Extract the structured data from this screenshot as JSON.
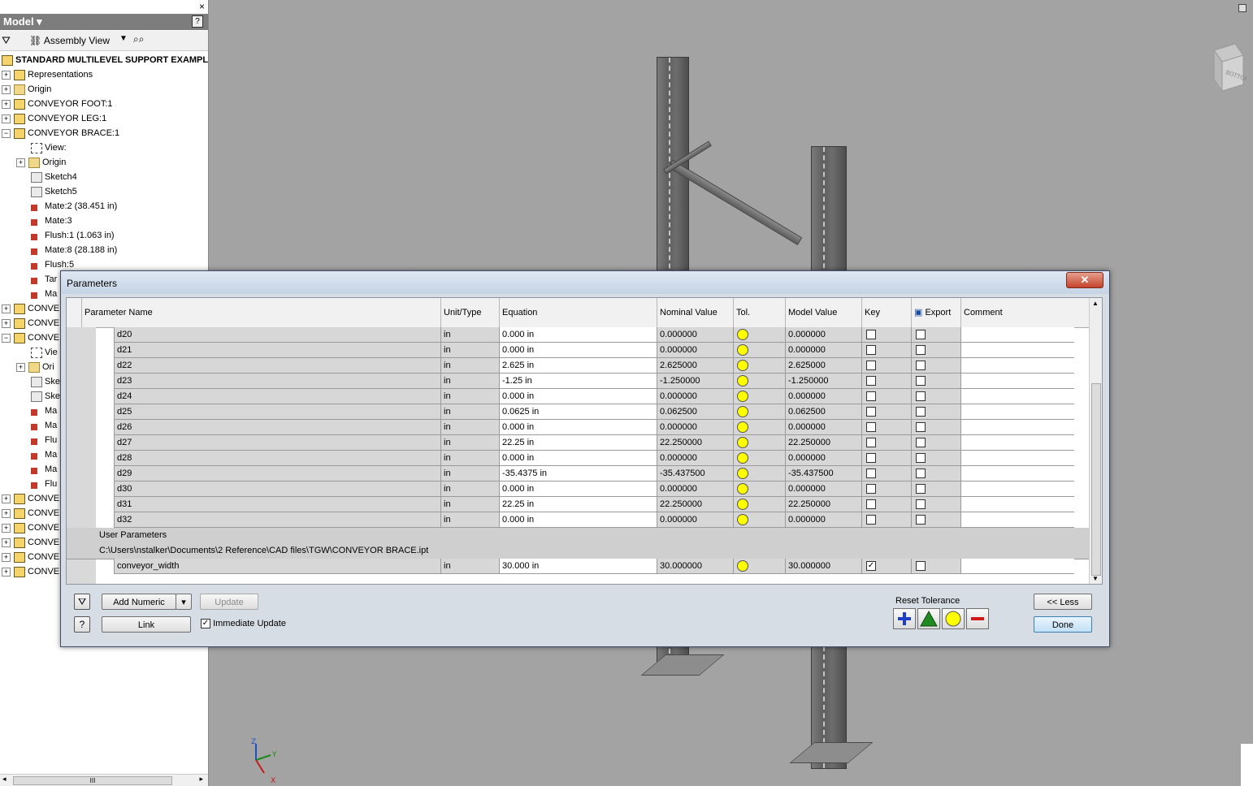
{
  "browser": {
    "title": "Model",
    "help": "?",
    "close": "×",
    "view_label": "Assembly View",
    "root": "STANDARD MULTILEVEL SUPPORT EXAMPL",
    "items": [
      {
        "label": "Representations",
        "icon": "representations-icon",
        "expander": "+"
      },
      {
        "label": "Origin",
        "icon": "folder-icon",
        "expander": "+"
      },
      {
        "label": "CONVEYOR FOOT:1",
        "icon": "part-icon",
        "expander": "+"
      },
      {
        "label": "CONVEYOR LEG:1",
        "icon": "part-icon",
        "expander": "+"
      },
      {
        "label": "CONVEYOR BRACE:1",
        "icon": "part-icon",
        "expander": "−"
      }
    ],
    "brace_children": [
      {
        "label": "View:",
        "icon": "view-icon"
      },
      {
        "label": "Origin",
        "icon": "folder-icon"
      },
      {
        "label": "Sketch4",
        "icon": "sketch-icon"
      },
      {
        "label": "Sketch5",
        "icon": "sketch-icon"
      },
      {
        "label": "Mate:2 (38.451 in)",
        "icon": "mate-icon"
      },
      {
        "label": "Mate:3",
        "icon": "mate-icon"
      },
      {
        "label": "Flush:1 (1.063 in)",
        "icon": "flush-icon"
      },
      {
        "label": "Mate:8 (28.188 in)",
        "icon": "mate-icon"
      },
      {
        "label": "Flush:5",
        "icon": "flush-icon"
      },
      {
        "label": "Tar",
        "icon": "tangent-icon"
      },
      {
        "label": "Ma",
        "icon": "mate-icon"
      }
    ],
    "more_items": [
      {
        "label": "CONVE"
      },
      {
        "label": "CONVE"
      },
      {
        "label": "CONVE"
      }
    ],
    "sub2": [
      {
        "label": "Vie"
      },
      {
        "label": "Ori"
      },
      {
        "label": "Ske"
      },
      {
        "label": "Ske"
      },
      {
        "label": "Ma"
      },
      {
        "label": "Ma"
      },
      {
        "label": "Flu"
      },
      {
        "label": "Ma"
      },
      {
        "label": "Ma"
      },
      {
        "label": "Flu"
      }
    ],
    "tail_items": [
      {
        "label": "CONVE"
      },
      {
        "label": "CONVE"
      },
      {
        "label": "CONVE"
      },
      {
        "label": "CONVE"
      },
      {
        "label": "CONVE"
      },
      {
        "label": "CONVE"
      }
    ],
    "scroll_thumb": "III"
  },
  "viewport": {
    "axes": {
      "z": "Z",
      "y": "Y",
      "x": "X"
    },
    "viewcube_label": "BOTTOM"
  },
  "dialog": {
    "title": "Parameters",
    "close": "✕",
    "columns": [
      "Parameter Name",
      "Unit/Type",
      "Equation",
      "Nominal Value",
      "Tol.",
      "Model Value",
      "Key",
      "Export",
      "Comment"
    ],
    "rows": [
      {
        "name": "d20",
        "unit": "in",
        "equation": "0.000 in",
        "nominal": "0.000000",
        "model": "0.000000",
        "key": false,
        "export": false
      },
      {
        "name": "d21",
        "unit": "in",
        "equation": "0.000 in",
        "nominal": "0.000000",
        "model": "0.000000",
        "key": false,
        "export": false
      },
      {
        "name": "d22",
        "unit": "in",
        "equation": "2.625 in",
        "nominal": "2.625000",
        "model": "2.625000",
        "key": false,
        "export": false
      },
      {
        "name": "d23",
        "unit": "in",
        "equation": "-1.25 in",
        "nominal": "-1.250000",
        "model": "-1.250000",
        "key": false,
        "export": false
      },
      {
        "name": "d24",
        "unit": "in",
        "equation": "0.000 in",
        "nominal": "0.000000",
        "model": "0.000000",
        "key": false,
        "export": false
      },
      {
        "name": "d25",
        "unit": "in",
        "equation": "0.0625 in",
        "nominal": "0.062500",
        "model": "0.062500",
        "key": false,
        "export": false
      },
      {
        "name": "d26",
        "unit": "in",
        "equation": "0.000 in",
        "nominal": "0.000000",
        "model": "0.000000",
        "key": false,
        "export": false
      },
      {
        "name": "d27",
        "unit": "in",
        "equation": "22.25 in",
        "nominal": "22.250000",
        "model": "22.250000",
        "key": false,
        "export": false
      },
      {
        "name": "d28",
        "unit": "in",
        "equation": "0.000 in",
        "nominal": "0.000000",
        "model": "0.000000",
        "key": false,
        "export": false
      },
      {
        "name": "d29",
        "unit": "in",
        "equation": "-35.4375 in",
        "nominal": "-35.437500",
        "model": "-35.437500",
        "key": false,
        "export": false
      },
      {
        "name": "d30",
        "unit": "in",
        "equation": "0.000 in",
        "nominal": "0.000000",
        "model": "0.000000",
        "key": false,
        "export": false
      },
      {
        "name": "d31",
        "unit": "in",
        "equation": "22.25 in",
        "nominal": "22.250000",
        "model": "22.250000",
        "key": false,
        "export": false
      },
      {
        "name": "d32",
        "unit": "in",
        "equation": "0.000 in",
        "nominal": "0.000000",
        "model": "0.000000",
        "key": false,
        "export": false
      }
    ],
    "user_params_label": "User Parameters",
    "file_path": "C:\\Users\\nstalker\\Documents\\2 Reference\\CAD files\\TGW\\CONVEYOR BRACE.ipt",
    "user_rows": [
      {
        "name": "conveyor_width",
        "unit": "in",
        "equation": "30.000 in",
        "nominal": "30.000000",
        "model": "30.000000",
        "key": true,
        "export": false
      }
    ],
    "buttons": {
      "add_numeric": "Add Numeric",
      "update": "Update",
      "link": "Link",
      "immediate_update": "Immediate Update",
      "reset_tolerance": "Reset Tolerance",
      "less": "<< Less",
      "done": "Done"
    },
    "immediate_update_checked": true,
    "colors": {
      "tolerance_dot": "#ffff00",
      "plus": "#1f3fc8",
      "triangle": "#1f8a1f",
      "minus": "#d01818"
    }
  }
}
